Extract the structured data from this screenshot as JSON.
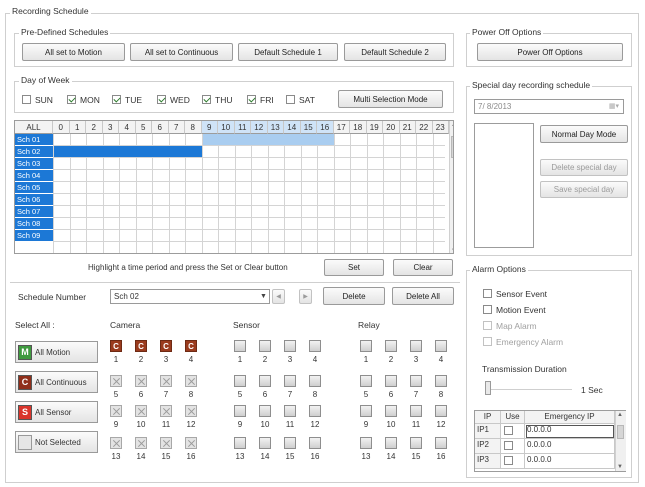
{
  "recording_schedule_label": "Recording Schedule",
  "predefined": {
    "label": "Pre-Defined Schedules",
    "buttons": [
      "All set to Motion",
      "All set to Continuous",
      "Default Schedule 1",
      "Default Schedule 2"
    ]
  },
  "day_of_week": {
    "label": "Day of Week",
    "days": [
      {
        "label": "SUN",
        "checked": false
      },
      {
        "label": "MON",
        "checked": true
      },
      {
        "label": "TUE",
        "checked": true
      },
      {
        "label": "WED",
        "checked": true
      },
      {
        "label": "THU",
        "checked": true
      },
      {
        "label": "FRI",
        "checked": true
      },
      {
        "label": "SAT",
        "checked": false
      }
    ],
    "multi_button": "Multi Selection Mode"
  },
  "grid": {
    "all_label": "ALL",
    "hours": [
      "0",
      "1",
      "2",
      "3",
      "4",
      "5",
      "6",
      "7",
      "8",
      "9",
      "10",
      "11",
      "12",
      "13",
      "14",
      "15",
      "16",
      "17",
      "18",
      "19",
      "20",
      "21",
      "22",
      "23"
    ],
    "rows": [
      "Sch 01",
      "Sch 02",
      "Sch 03",
      "Sch 04",
      "Sch 05",
      "Sch 06",
      "Sch 07",
      "Sch 08",
      "Sch 09"
    ],
    "fills": [
      {
        "row": 0,
        "from": 9,
        "to": 16,
        "color": "#a9cdf0"
      },
      {
        "row": 1,
        "from": 0,
        "to": 8,
        "color": "#1c78d6"
      }
    ]
  },
  "hint": "Highlight a time period and press the Set or Clear button",
  "set_button": "Set",
  "clear_button": "Clear",
  "schedule_number": {
    "label": "Schedule Number",
    "value": "Sch 02",
    "delete_button": "Delete",
    "delete_all_button": "Delete All"
  },
  "select_all": {
    "label": "Select All :",
    "buttons": [
      {
        "letter": "M",
        "label": "All Motion",
        "color": "#3f9a3f"
      },
      {
        "letter": "C",
        "label": "All Continuous",
        "color": "#8f2e1a"
      },
      {
        "letter": "S",
        "label": "All Sensor",
        "color": "#d9342b"
      },
      {
        "letter": "",
        "label": "Not Selected",
        "color": "#e6e6e6"
      }
    ]
  },
  "camera_label": "Camera",
  "sensor_label": "Sensor",
  "relay_label": "Relay",
  "channel_numbers": [
    "1",
    "2",
    "3",
    "4",
    "5",
    "6",
    "7",
    "8",
    "9",
    "10",
    "11",
    "12",
    "13",
    "14",
    "15",
    "16"
  ],
  "camera_active_letter": "C",
  "power_off": {
    "label": "Power Off Options",
    "button": "Power Off Options"
  },
  "special_day": {
    "label": "Special day recording schedule",
    "date": "7/ 8/2013",
    "normal_button": "Normal Day Mode",
    "delete_button": "Delete special day",
    "save_button": "Save special day"
  },
  "alarm": {
    "label": "Alarm Options",
    "options": [
      {
        "label": "Sensor Event",
        "checked": false,
        "enabled": true
      },
      {
        "label": "Motion Event",
        "checked": false,
        "enabled": true
      },
      {
        "label": "Map Alarm",
        "checked": false,
        "enabled": false
      },
      {
        "label": "Emergency Alarm",
        "checked": false,
        "enabled": false
      }
    ],
    "transmission_label": "Transmission Duration",
    "transmission_value": "1 Sec",
    "ip_table": {
      "headers": [
        "IP",
        "Use",
        "Emergency IP"
      ],
      "rows": [
        {
          "ip": "IP1",
          "use": false,
          "addr": "0.0.0.0"
        },
        {
          "ip": "IP2",
          "use": false,
          "addr": "0.0.0.0"
        },
        {
          "ip": "IP3",
          "use": false,
          "addr": "0.0.0.0"
        }
      ]
    }
  }
}
